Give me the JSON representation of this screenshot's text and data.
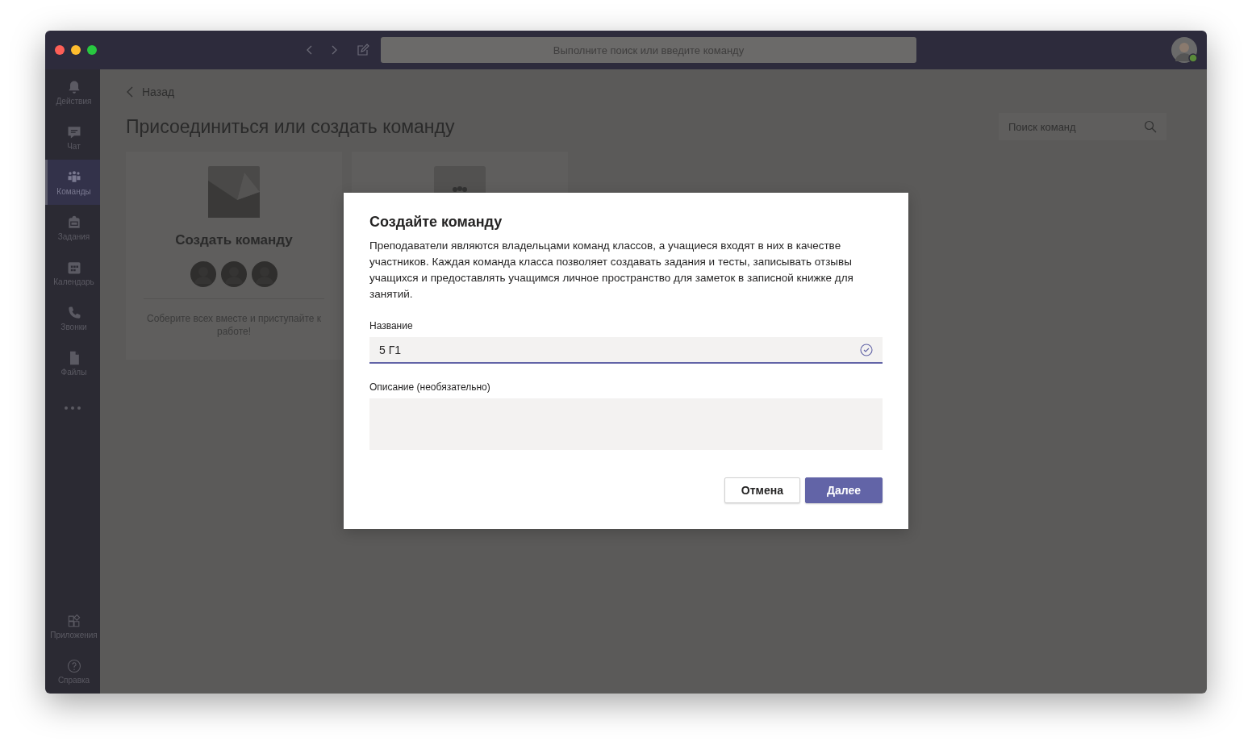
{
  "title_bar": {
    "search_placeholder": "Выполните поиск или введите команду"
  },
  "sidebar": {
    "items": [
      {
        "kind": "bell",
        "label": "Действия",
        "selected": false
      },
      {
        "kind": "chat",
        "label": "Чат",
        "selected": false
      },
      {
        "kind": "teams",
        "label": "Команды",
        "selected": true
      },
      {
        "kind": "bag",
        "label": "Задания",
        "selected": false
      },
      {
        "kind": "calendar",
        "label": "Календарь",
        "selected": false
      },
      {
        "kind": "phone",
        "label": "Звонки",
        "selected": false
      },
      {
        "kind": "file",
        "label": "Файлы",
        "selected": false
      }
    ],
    "bottom_items": [
      {
        "kind": "apps",
        "label": "Приложения",
        "selected": false
      },
      {
        "kind": "help",
        "label": "Справка",
        "selected": false
      }
    ]
  },
  "page": {
    "back": "Назад",
    "title": "Присоединиться или создать команду",
    "search_placeholder": "Поиск команд",
    "cards": [
      {
        "kind": "create",
        "title": "Создать команду",
        "description": "Соберите всех вместе и приступайте к работе!"
      },
      {
        "kind": "join"
      }
    ]
  },
  "dialog": {
    "title": "Создайте команду",
    "body": "Преподаватели являются владельцами команд классов, а учащиеся входят в них в качестве участников. Каждая команда класса позволяет создавать задания и тесты, записывать отзывы учащихся и предоставлять учащимся личное пространство для заметок в записной книжке для занятий.",
    "fields": [
      {
        "kind": "line",
        "label": "Название",
        "value": "5 Г1",
        "valid": true
      },
      {
        "kind": "area",
        "label": "Описание (необязательно)"
      }
    ],
    "buttons": [
      {
        "kind": "secondary",
        "label": "Отмена"
      },
      {
        "kind": "primary",
        "label": "Далее"
      }
    ]
  }
}
